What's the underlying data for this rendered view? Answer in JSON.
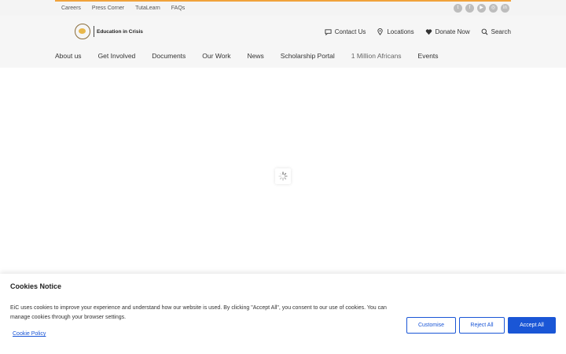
{
  "topbar": {
    "links": [
      "Careers",
      "Press Corner",
      "TutaLearn",
      "FAQs"
    ],
    "social_icons": [
      "twitter-icon",
      "facebook-icon",
      "youtube-icon",
      "instagram-icon",
      "linkedin-icon"
    ],
    "accent_color": "#f0a23b"
  },
  "header": {
    "logo_text": "Education in Crisis",
    "utility": {
      "contact": "Contact Us",
      "locations": "Locations",
      "donate": "Donate Now",
      "search": "Search"
    },
    "nav": [
      "About us",
      "Get Involved",
      "Documents",
      "Our Work",
      "News",
      "Scholarship Portal",
      "1 Million Africans",
      "Events"
    ]
  },
  "cookie": {
    "title": "Cookies Notice",
    "text": "EiC uses cookies to improve your experience and understand how our website is used. By clicking \"Accept All\", you consent to our use of cookies. You can manage cookies through your browser settings.",
    "policy_link": "Cookie Policy",
    "buttons": {
      "customise": "Customise",
      "reject": "Reject All",
      "accept": "Accept All"
    },
    "button_color": "#1a56d6"
  }
}
